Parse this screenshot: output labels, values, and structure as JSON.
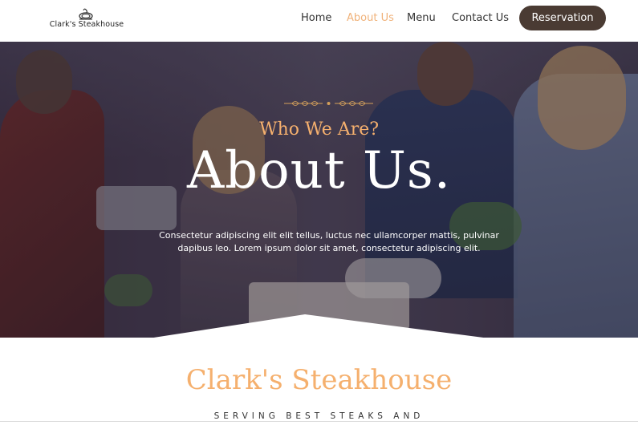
{
  "header": {
    "logo_text": "Clark's Steakhouse",
    "logo_icon": "steak-plate-icon",
    "nav": [
      {
        "label": "Home",
        "active": false
      },
      {
        "label": "About Us",
        "active": true
      },
      {
        "label": "Menu",
        "active": false
      },
      {
        "label": "Contact Us",
        "active": false
      }
    ],
    "reservation_label": "Reservation"
  },
  "hero": {
    "ornament_icon": "wheat-ornament-icon",
    "kicker": "Who We Are?",
    "headline": "About Us.",
    "description": "Consectetur adipiscing elit elit tellus, luctus nec ullamcorper mattis, pulvinar dapibus leo. Lorem ipsum dolor sit amet, consectetur adipiscing elit."
  },
  "section": {
    "title": "Clark's Steakhouse",
    "subtitle": "SERVING BEST STEAKS AND"
  },
  "colors": {
    "accent": "#f5b06e",
    "button": "#4a3b33",
    "nav_active": "#f0b27a"
  }
}
